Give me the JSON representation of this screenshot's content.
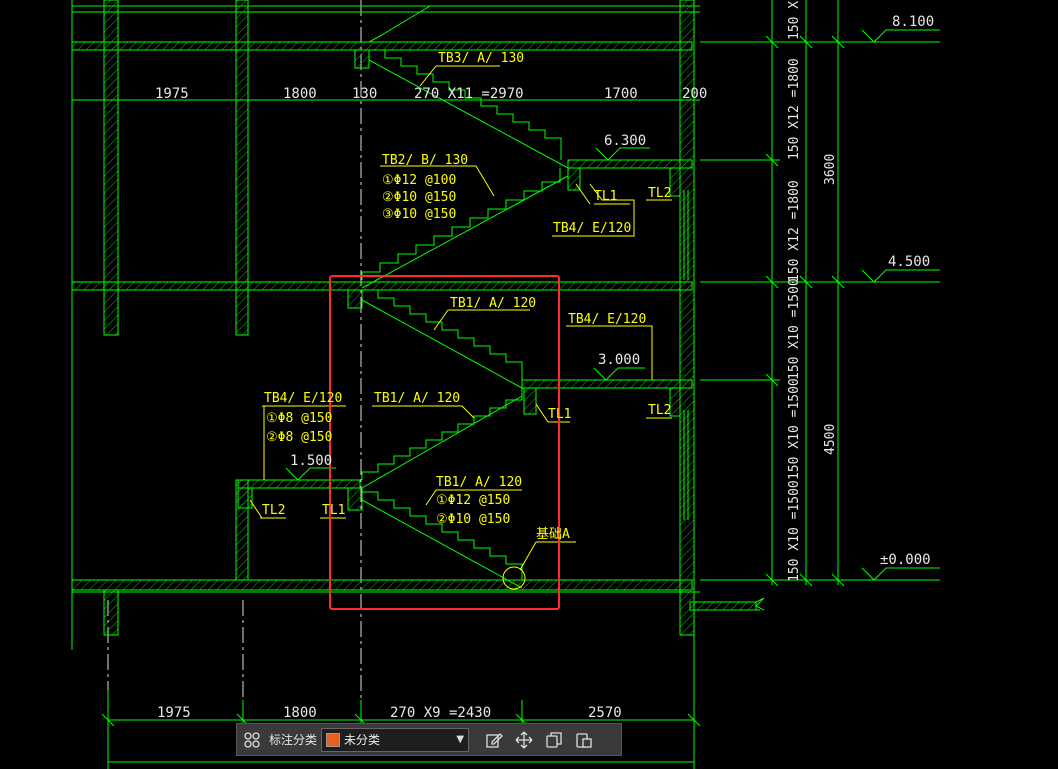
{
  "drawing": {
    "elevations": [
      "8.100",
      "4.500",
      "±0.000"
    ],
    "landing_levels": [
      "6.300",
      "3.000",
      "1.500"
    ],
    "dims_top": [
      "1975",
      "1800",
      "130",
      "270 X11 =2970",
      "1700",
      "200"
    ],
    "dims_bottom": [
      "1975",
      "1800",
      "270 X9 =2430",
      "2570"
    ],
    "dims_vertical": [
      "150 X12 =1800",
      "150 X12 =1800",
      "150 X10 =1500",
      "150 X10 =1500",
      "150 X10 =1500",
      "150 X10"
    ],
    "dims_storey": [
      "3600",
      "4500"
    ],
    "stair_labels": [
      "TB3/ A/ 130",
      "TB2/ B/ 130",
      "TB1/ A/ 120",
      "TB1/ A/ 120",
      "TB1/ A/ 120"
    ],
    "tb2_rebar": [
      "①Φ12 @100",
      "②Φ10 @150",
      "③Φ10 @150"
    ],
    "tb1_rebar": [
      "①Φ12 @150",
      "②Φ10 @150"
    ],
    "tb4_upper": "TB4/ E/120",
    "tb4_mid": "TB4/ E/120",
    "tb4_left": "TB4/ E/120",
    "tb4_left_rebar": [
      "①Φ8 @150",
      "②Φ8 @150"
    ],
    "beams": [
      "TL1",
      "TL2",
      "TL1",
      "TL2",
      "TL2",
      "TL1"
    ],
    "foundation": "基础A",
    "colors": {
      "line": "#00ff00",
      "text": "#ffff00",
      "highlight": "#ff2a2a",
      "axis": "#ffffff"
    }
  },
  "toolbar": {
    "label": "标注分类",
    "selected": "未分类",
    "swatch_color": "#e8601c"
  }
}
